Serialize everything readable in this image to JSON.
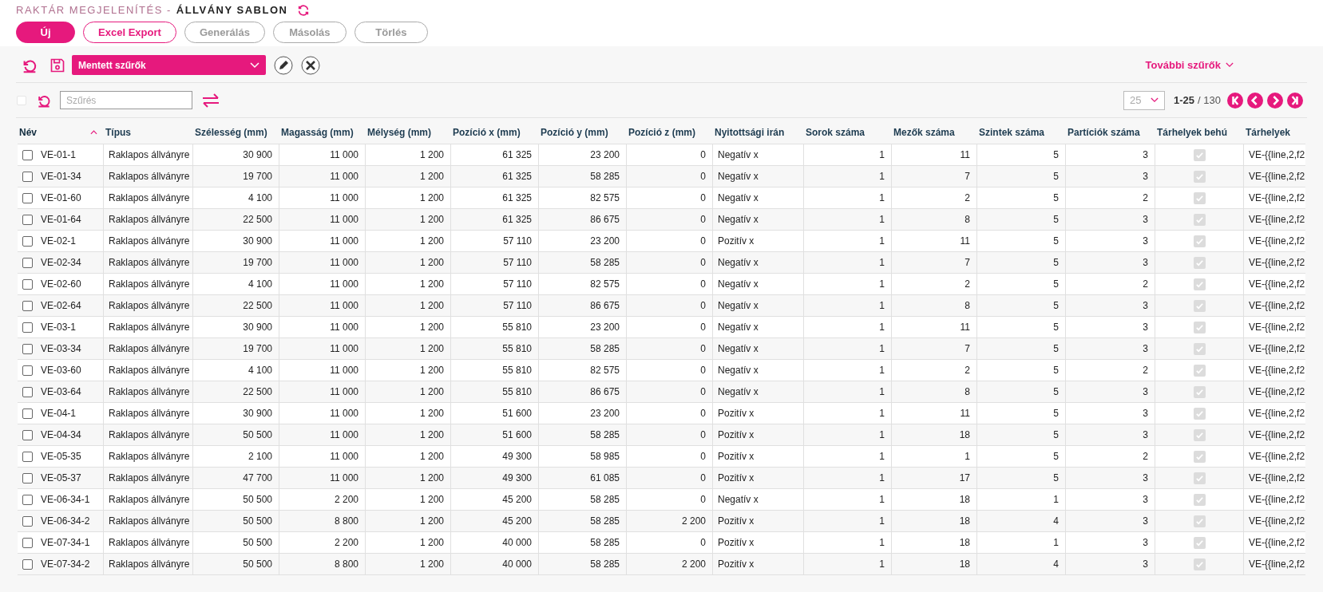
{
  "header": {
    "breadcrumb": "RAKTÁR MEGJELENÍTÉS -",
    "title": "ÁLLVÁNY SABLON"
  },
  "buttons": [
    {
      "label": "Új",
      "kind": "filled",
      "disabled": false
    },
    {
      "label": "Excel Export",
      "kind": "outline",
      "disabled": false
    },
    {
      "label": "Generálás",
      "kind": "outline",
      "disabled": true
    },
    {
      "label": "Másolás",
      "kind": "outline",
      "disabled": true
    },
    {
      "label": "Törlés",
      "kind": "outline",
      "disabled": true
    }
  ],
  "saved_filters": {
    "value": "Mentett szűrők"
  },
  "more_filters": "További szűrők",
  "filter": {
    "placeholder": "Szűrés",
    "select_all_checked": false
  },
  "pagination": {
    "page_size": "25",
    "range": "1-25",
    "total": "/ 130"
  },
  "table": {
    "columns": [
      {
        "label": "Név",
        "kind": "name",
        "sorted": true
      },
      {
        "label": "Típus",
        "kind": "text",
        "sorted": false
      },
      {
        "label": "Szélesség (mm)",
        "kind": "number",
        "sorted": false
      },
      {
        "label": "Magasság (mm)",
        "kind": "number",
        "sorted": false
      },
      {
        "label": "Mélység (mm)",
        "kind": "number",
        "sorted": false
      },
      {
        "label": "Pozíció x (mm)",
        "kind": "number",
        "sorted": false
      },
      {
        "label": "Pozíció y (mm)",
        "kind": "number",
        "sorted": false
      },
      {
        "label": "Pozíció z (mm)",
        "kind": "number",
        "sorted": false
      },
      {
        "label": "Nyitottsági irán",
        "kind": "text",
        "sorted": false
      },
      {
        "label": "Sorok száma",
        "kind": "number",
        "sorted": false
      },
      {
        "label": "Mezők száma",
        "kind": "number",
        "sorted": false
      },
      {
        "label": "Szintek száma",
        "kind": "number",
        "sorted": false
      },
      {
        "label": "Partíciók száma",
        "kind": "number",
        "sorted": false
      },
      {
        "label": "Tárhelyek behú",
        "kind": "check",
        "sorted": false
      },
      {
        "label": "Tárhelyek",
        "kind": "text",
        "sorted": false
      }
    ],
    "rows": [
      {
        "selected": false,
        "cells": [
          "VE-01-1",
          "Raklapos állványre",
          "30 900",
          "11 000",
          "1 200",
          "61 325",
          "23 200",
          "0",
          "Negatív x",
          "1",
          "11",
          "5",
          "3",
          true,
          "VE-{{line,2,f2"
        ]
      },
      {
        "selected": false,
        "cells": [
          "VE-01-34",
          "Raklapos állványre",
          "19 700",
          "11 000",
          "1 200",
          "61 325",
          "58 285",
          "0",
          "Negatív x",
          "1",
          "7",
          "5",
          "3",
          true,
          "VE-{{line,2,f2"
        ]
      },
      {
        "selected": false,
        "cells": [
          "VE-01-60",
          "Raklapos állványre",
          "4 100",
          "11 000",
          "1 200",
          "61 325",
          "82 575",
          "0",
          "Negatív x",
          "1",
          "2",
          "5",
          "2",
          true,
          "VE-{{line,2,f2"
        ]
      },
      {
        "selected": false,
        "cells": [
          "VE-01-64",
          "Raklapos állványre",
          "22 500",
          "11 000",
          "1 200",
          "61 325",
          "86 675",
          "0",
          "Negatív x",
          "1",
          "8",
          "5",
          "3",
          true,
          "VE-{{line,2,f2"
        ]
      },
      {
        "selected": false,
        "cells": [
          "VE-02-1",
          "Raklapos állványre",
          "30 900",
          "11 000",
          "1 200",
          "57 110",
          "23 200",
          "0",
          "Pozitív x",
          "1",
          "11",
          "5",
          "3",
          true,
          "VE-{{line,2,f2"
        ]
      },
      {
        "selected": false,
        "cells": [
          "VE-02-34",
          "Raklapos állványre",
          "19 700",
          "11 000",
          "1 200",
          "57 110",
          "58 285",
          "0",
          "Negatív x",
          "1",
          "7",
          "5",
          "3",
          true,
          "VE-{{line,2,f2"
        ]
      },
      {
        "selected": false,
        "cells": [
          "VE-02-60",
          "Raklapos állványre",
          "4 100",
          "11 000",
          "1 200",
          "57 110",
          "82 575",
          "0",
          "Negatív x",
          "1",
          "2",
          "5",
          "2",
          true,
          "VE-{{line,2,f2"
        ]
      },
      {
        "selected": false,
        "cells": [
          "VE-02-64",
          "Raklapos állványre",
          "22 500",
          "11 000",
          "1 200",
          "57 110",
          "86 675",
          "0",
          "Negatív x",
          "1",
          "8",
          "5",
          "3",
          true,
          "VE-{{line,2,f2"
        ]
      },
      {
        "selected": false,
        "cells": [
          "VE-03-1",
          "Raklapos állványre",
          "30 900",
          "11 000",
          "1 200",
          "55 810",
          "23 200",
          "0",
          "Negatív x",
          "1",
          "11",
          "5",
          "3",
          true,
          "VE-{{line,2,f2"
        ]
      },
      {
        "selected": false,
        "cells": [
          "VE-03-34",
          "Raklapos állványre",
          "19 700",
          "11 000",
          "1 200",
          "55 810",
          "58 285",
          "0",
          "Negatív x",
          "1",
          "7",
          "5",
          "3",
          true,
          "VE-{{line,2,f2"
        ]
      },
      {
        "selected": false,
        "cells": [
          "VE-03-60",
          "Raklapos állványre",
          "4 100",
          "11 000",
          "1 200",
          "55 810",
          "82 575",
          "0",
          "Negatív x",
          "1",
          "2",
          "5",
          "2",
          true,
          "VE-{{line,2,f2"
        ]
      },
      {
        "selected": false,
        "cells": [
          "VE-03-64",
          "Raklapos állványre",
          "22 500",
          "11 000",
          "1 200",
          "55 810",
          "86 675",
          "0",
          "Negatív x",
          "1",
          "8",
          "5",
          "3",
          true,
          "VE-{{line,2,f2"
        ]
      },
      {
        "selected": false,
        "cells": [
          "VE-04-1",
          "Raklapos állványre",
          "30 900",
          "11 000",
          "1 200",
          "51 600",
          "23 200",
          "0",
          "Pozitív x",
          "1",
          "11",
          "5",
          "3",
          true,
          "VE-{{line,2,f2"
        ]
      },
      {
        "selected": false,
        "cells": [
          "VE-04-34",
          "Raklapos állványre",
          "50 500",
          "11 000",
          "1 200",
          "51 600",
          "58 285",
          "0",
          "Pozitív x",
          "1",
          "18",
          "5",
          "3",
          true,
          "VE-{{line,2,f2"
        ]
      },
      {
        "selected": false,
        "cells": [
          "VE-05-35",
          "Raklapos állványre",
          "2 100",
          "11 000",
          "1 200",
          "49 300",
          "58 985",
          "0",
          "Pozitív x",
          "1",
          "1",
          "5",
          "2",
          true,
          "VE-{{line,2,f2"
        ]
      },
      {
        "selected": false,
        "cells": [
          "VE-05-37",
          "Raklapos állványre",
          "47 700",
          "11 000",
          "1 200",
          "49 300",
          "61 085",
          "0",
          "Pozitív x",
          "1",
          "17",
          "5",
          "3",
          true,
          "VE-{{line,2,f2"
        ]
      },
      {
        "selected": false,
        "cells": [
          "VE-06-34-1",
          "Raklapos állványre",
          "50 500",
          "2 200",
          "1 200",
          "45 200",
          "58 285",
          "0",
          "Negatív x",
          "1",
          "18",
          "1",
          "3",
          true,
          "VE-{{line,2,f2"
        ]
      },
      {
        "selected": false,
        "cells": [
          "VE-06-34-2",
          "Raklapos állványre",
          "50 500",
          "8 800",
          "1 200",
          "45 200",
          "58 285",
          "2 200",
          "Pozitív x",
          "1",
          "18",
          "4",
          "3",
          true,
          "VE-{{line,2,f2"
        ]
      },
      {
        "selected": false,
        "cells": [
          "VE-07-34-1",
          "Raklapos állványre",
          "50 500",
          "2 200",
          "1 200",
          "40 000",
          "58 285",
          "0",
          "Pozitív x",
          "1",
          "18",
          "1",
          "3",
          true,
          "VE-{{line,2,f2"
        ]
      },
      {
        "selected": false,
        "cells": [
          "VE-07-34-2",
          "Raklapos állványre",
          "50 500",
          "8 800",
          "1 200",
          "40 000",
          "58 285",
          "2 200",
          "Pozitív x",
          "1",
          "18",
          "4",
          "3",
          true,
          "VE-{{line,2,f2"
        ]
      }
    ]
  }
}
